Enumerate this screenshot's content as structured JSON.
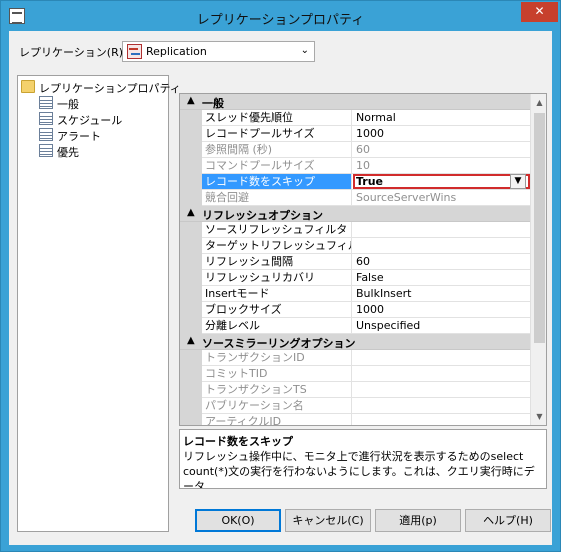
{
  "window": {
    "title": "レプリケーションプロパティ",
    "close_label": "✕"
  },
  "replication": {
    "label": "レプリケーション(R)",
    "selected": "Replication"
  },
  "tree": {
    "root": "レプリケーションプロパティ",
    "children": [
      "一般",
      "スケジュール",
      "アラート",
      "優先"
    ]
  },
  "grid": {
    "categories": [
      {
        "name": "一般",
        "items": [
          {
            "name": "スレッド優先順位",
            "value": "Normal"
          },
          {
            "name": "レコードプールサイズ",
            "value": "1000"
          },
          {
            "name": "参照間隔 (秒)",
            "value": "60"
          },
          {
            "name": "コマンドプールサイズ",
            "value": "10"
          },
          {
            "name": "レコード数をスキップ",
            "value": "True"
          },
          {
            "name": "競合回避",
            "value": "SourceServerWins"
          }
        ]
      },
      {
        "name": "リフレッシュオプション",
        "items": [
          {
            "name": "ソースリフレッシュフィルタ",
            "value": ""
          },
          {
            "name": "ターゲットリフレッシュフィルタ",
            "value": ""
          },
          {
            "name": "リフレッシュ間隔",
            "value": "60"
          },
          {
            "name": "リフレッシュリカバリ",
            "value": "False"
          },
          {
            "name": "Insertモード",
            "value": "BulkInsert"
          },
          {
            "name": "ブロックサイズ",
            "value": "1000"
          },
          {
            "name": "分離レベル",
            "value": "Unspecified"
          }
        ]
      },
      {
        "name": "ソースミラーリングオプション",
        "items": [
          {
            "name": "トランザクションID",
            "value": ""
          },
          {
            "name": "コミットTID",
            "value": ""
          },
          {
            "name": "トランザクションTS",
            "value": ""
          },
          {
            "name": "パブリケーション名",
            "value": ""
          },
          {
            "name": "アーティクルID",
            "value": ""
          }
        ]
      }
    ]
  },
  "description": {
    "title": "レコード数をスキップ",
    "body": "リフレッシュ操作中に、モニタ上で進行状況を表示するためのselect count(*)文の実行を行わないようにします。これは、クエリ実行時にデータ..."
  },
  "buttons": {
    "ok": "OK(O)",
    "cancel": "キャンセル(C)",
    "apply": "適用(p)",
    "help": "ヘルプ(H)"
  }
}
